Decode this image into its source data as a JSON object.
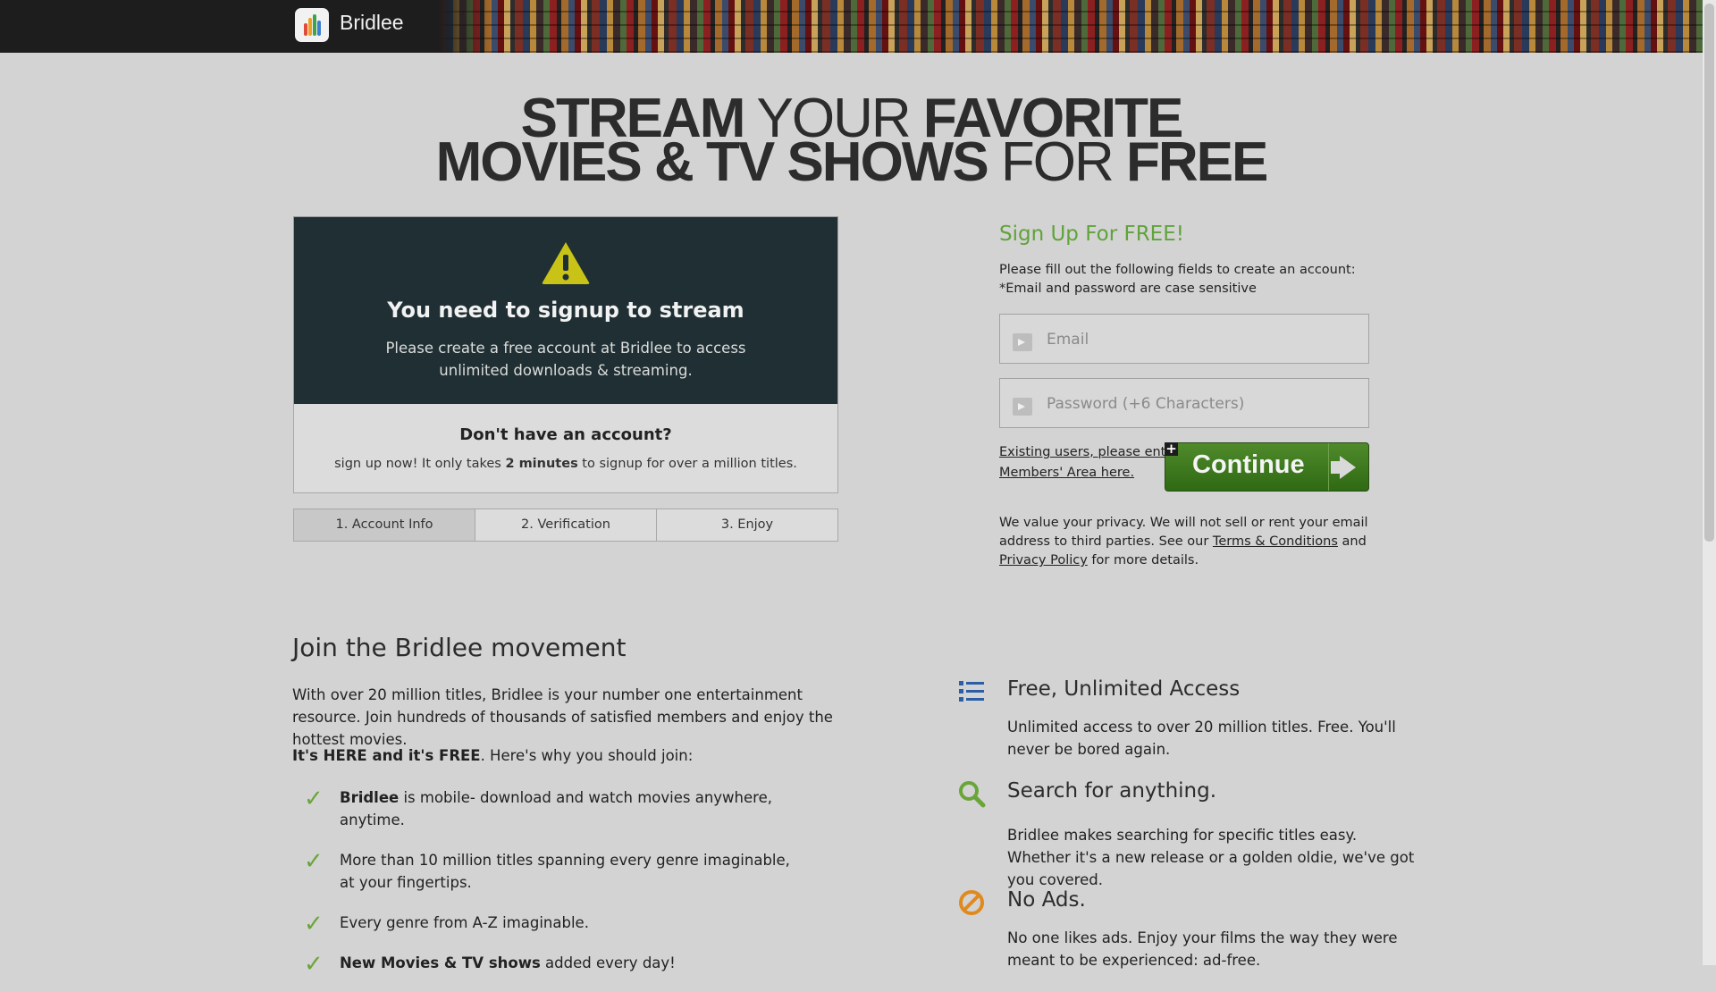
{
  "header": {
    "brand": "Bridlee"
  },
  "hero": {
    "line1": [
      "STREAM",
      "YOUR",
      "FAVORITE"
    ],
    "line2": [
      "MOVIES & TV SHOWS",
      "FOR",
      "FREE"
    ]
  },
  "notice": {
    "title": "You need to signup to stream",
    "text_line1": "Please create a free account at Bridlee to access",
    "text_line2": "unlimited downloads & streaming."
  },
  "no_account": {
    "title": "Don't have an account?",
    "text_pre": "sign up now! It only takes ",
    "text_bold": "2 minutes",
    "text_post": " to signup for over a million titles."
  },
  "steps": [
    "1. Account Info",
    "2. Verification",
    "3. Enjoy"
  ],
  "signup": {
    "title": "Sign Up For FREE!",
    "desc_line1": "Please fill out the following fields to create an account:",
    "desc_line2": "*Email and password are case sensitive",
    "email_placeholder": "Email",
    "password_placeholder": "Password (+6 Characters)",
    "existing_line1": "Existing users, please enter",
    "existing_line2": "Members' Area here.",
    "continue_label": "Continue",
    "privacy_pre": "We value your privacy. We will not sell or rent your email address to third parties. See our ",
    "terms_link": "Terms & Conditions",
    "privacy_mid": " and ",
    "privacy_link": "Privacy Policy",
    "privacy_post": " for more details."
  },
  "join": {
    "heading": "Join the Bridlee movement",
    "para": "With over 20 million titles, Bridlee is your number one entertainment resource. Join hundreds of thousands of satisfied members and enjoy the hottest movies.",
    "here_bold": "It's HERE and it's FREE",
    "here_rest": ". Here's why you should join:",
    "checks": [
      {
        "bold": "Bridlee",
        "text": " is mobile- download and watch movies anywhere, anytime."
      },
      {
        "bold": "",
        "text": "More than 10 million titles spanning every genre imaginable, at your fingertips."
      },
      {
        "bold": "",
        "text": "Every genre from A-Z imaginable."
      },
      {
        "bold": "New Movies & TV shows",
        "text": " added every day!"
      }
    ]
  },
  "features": [
    {
      "icon": "list-icon",
      "title": "Free, Unlimited Access",
      "text": "Unlimited access to over 20 million titles. Free. You'll never be bored again."
    },
    {
      "icon": "search-icon",
      "title": "Search for anything.",
      "text": "Bridlee makes searching for specific titles easy. Whether it's a new release or a golden oldie, we've got you covered."
    },
    {
      "icon": "no-ads-icon",
      "title": "No Ads.",
      "text": "No one likes ads. Enjoy your films the way they were meant to be experienced: ad-free."
    }
  ],
  "colors": {
    "accent_green": "#5fa33a",
    "notice_bg": "#1f2f33",
    "warning_yellow": "#c9c317",
    "no_ads_orange": "#e08a1e",
    "icon_blue": "#2a5fa8"
  }
}
